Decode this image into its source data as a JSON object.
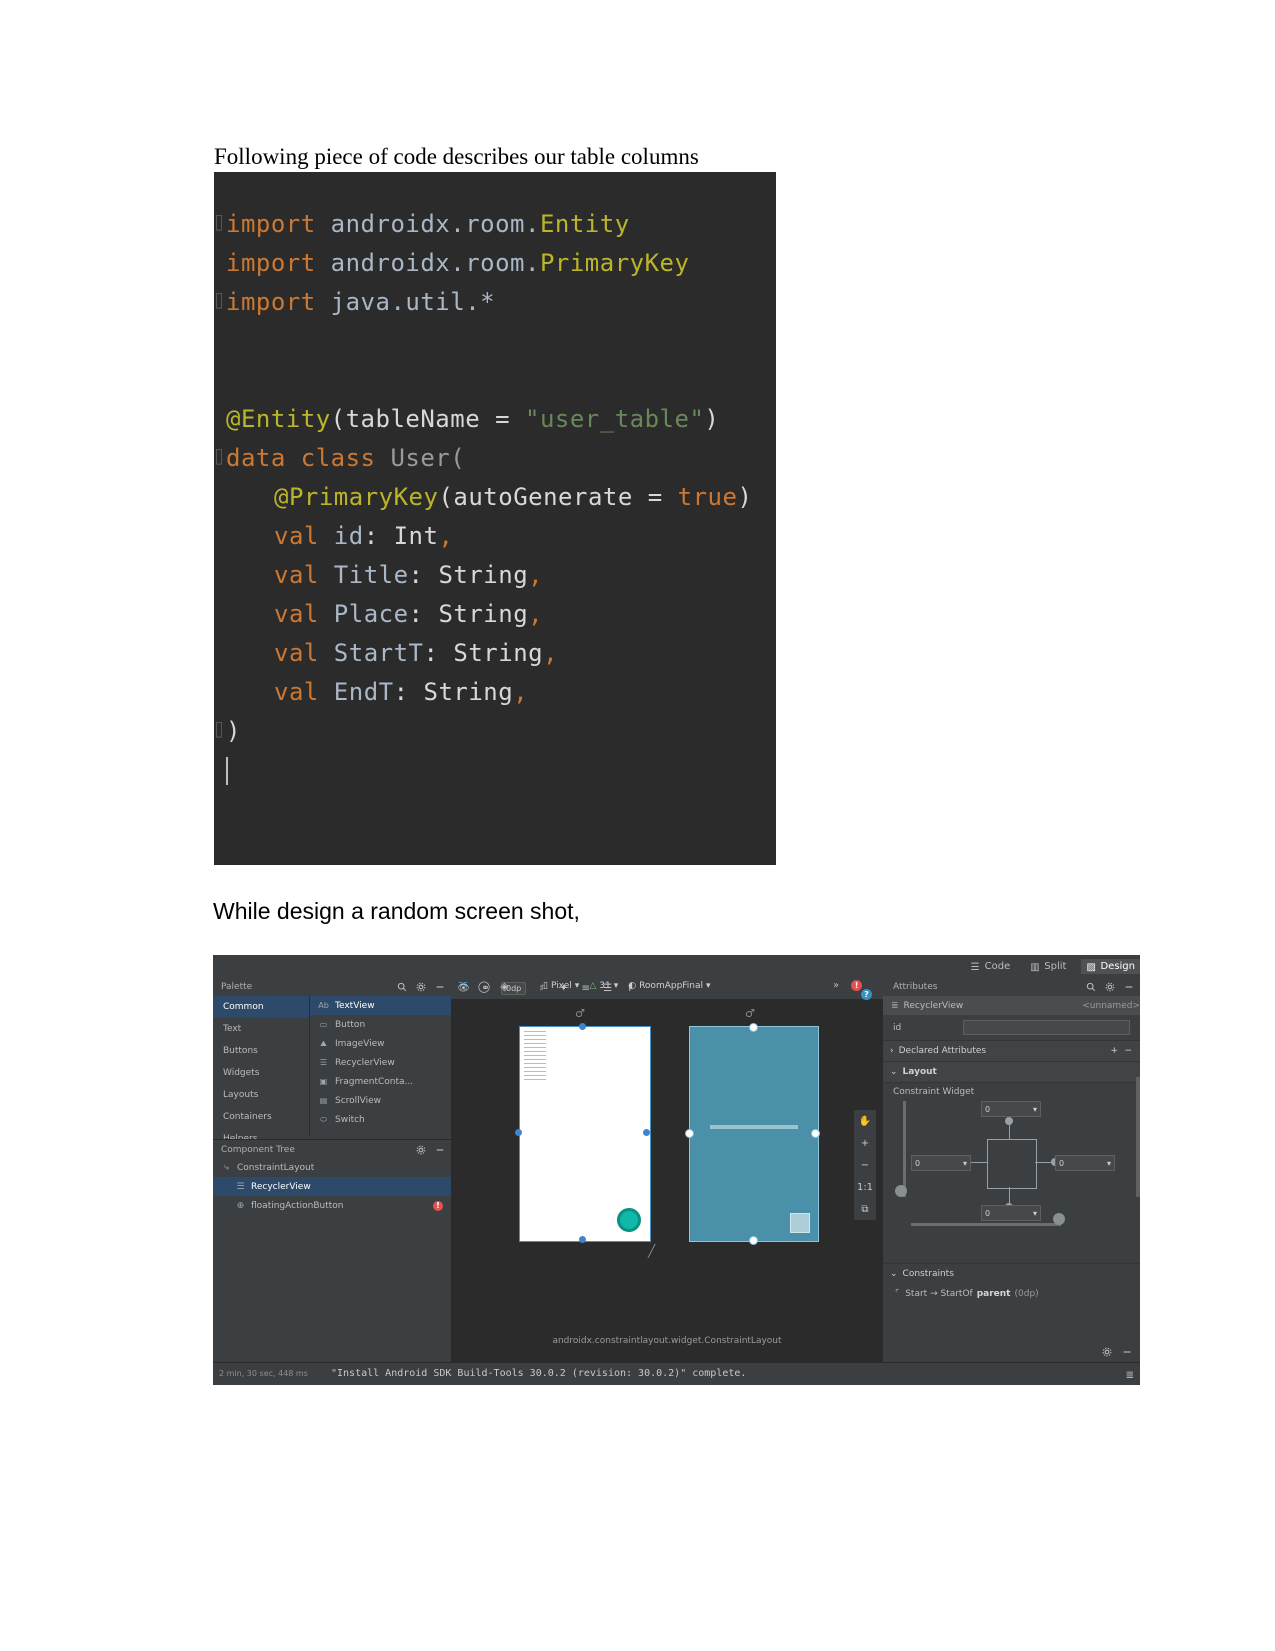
{
  "document": {
    "caption_1": "Following piece of code describes our table columns",
    "caption_2": "While design a random screen shot,"
  },
  "code_screenshot": {
    "language": "Kotlin",
    "lines": [
      {
        "indent": 0,
        "tokens": [
          {
            "t": "import",
            "c": "kw"
          },
          {
            "t": " androidx.room.",
            "c": "plain"
          },
          {
            "t": "Entity",
            "c": "ann"
          }
        ],
        "fold": true
      },
      {
        "indent": 0,
        "tokens": [
          {
            "t": "import",
            "c": "kw"
          },
          {
            "t": " androidx.room.",
            "c": "plain"
          },
          {
            "t": "PrimaryKey",
            "c": "ann"
          }
        ],
        "fold": false
      },
      {
        "indent": 0,
        "tokens": [
          {
            "t": "import",
            "c": "kw"
          },
          {
            "t": " java.util.*",
            "c": "plain"
          }
        ],
        "fold": true
      },
      {
        "indent": 0,
        "tokens": []
      },
      {
        "indent": 0,
        "tokens": []
      },
      {
        "indent": 0,
        "tokens": [
          {
            "t": "@Entity",
            "c": "ann"
          },
          {
            "t": "(tableName = ",
            "c": "white"
          },
          {
            "t": "\"user_table\"",
            "c": "str"
          },
          {
            "t": ")",
            "c": "white"
          }
        ],
        "fold": false
      },
      {
        "indent": 0,
        "tokens": [
          {
            "t": "data class ",
            "c": "kw"
          },
          {
            "t": "User(",
            "c": "ident"
          }
        ],
        "fold": true
      },
      {
        "indent": 1,
        "tokens": [
          {
            "t": "@PrimaryKey",
            "c": "ann"
          },
          {
            "t": "(autoGenerate = ",
            "c": "white"
          },
          {
            "t": "true",
            "c": "kw"
          },
          {
            "t": ")",
            "c": "white"
          }
        ],
        "fold": false
      },
      {
        "indent": 1,
        "tokens": [
          {
            "t": "val ",
            "c": "kw"
          },
          {
            "t": "id",
            "c": "plain"
          },
          {
            "t": ": ",
            "c": "white"
          },
          {
            "t": "Int",
            "c": "white"
          },
          {
            "t": ",",
            "c": "kw"
          }
        ],
        "fold": false
      },
      {
        "indent": 1,
        "tokens": [
          {
            "t": "val ",
            "c": "kw"
          },
          {
            "t": "Title",
            "c": "plain"
          },
          {
            "t": ": ",
            "c": "white"
          },
          {
            "t": "String",
            "c": "white"
          },
          {
            "t": ",",
            "c": "kw"
          }
        ],
        "fold": false
      },
      {
        "indent": 1,
        "tokens": [
          {
            "t": "val ",
            "c": "kw"
          },
          {
            "t": "Place",
            "c": "plain"
          },
          {
            "t": ": ",
            "c": "white"
          },
          {
            "t": "String",
            "c": "white"
          },
          {
            "t": ",",
            "c": "kw"
          }
        ],
        "fold": false
      },
      {
        "indent": 1,
        "tokens": [
          {
            "t": "val ",
            "c": "kw"
          },
          {
            "t": "StartT",
            "c": "plain"
          },
          {
            "t": ": ",
            "c": "white"
          },
          {
            "t": "String",
            "c": "white"
          },
          {
            "t": ",",
            "c": "kw"
          }
        ],
        "fold": false
      },
      {
        "indent": 1,
        "tokens": [
          {
            "t": "val ",
            "c": "kw"
          },
          {
            "t": "EndT",
            "c": "plain"
          },
          {
            "t": ": ",
            "c": "white"
          },
          {
            "t": "String",
            "c": "white"
          },
          {
            "t": ",",
            "c": "kw"
          }
        ],
        "fold": false
      },
      {
        "indent": 0,
        "tokens": [
          {
            "t": ")",
            "c": "white"
          }
        ],
        "fold": true
      }
    ],
    "colors": {
      "background": "#2b2b2b",
      "keyword": "#cc7832",
      "annotation": "#bbb529",
      "string": "#6a8759",
      "plain": "#a9b7c6",
      "identifier": "#9a9a9a"
    }
  },
  "android_studio": {
    "editor_tabs": [
      {
        "label": "Code",
        "icon": "code-lines-icon",
        "active": false
      },
      {
        "label": "Split",
        "icon": "split-pane-icon",
        "active": false
      },
      {
        "label": "Design",
        "icon": "design-preview-icon",
        "active": true
      }
    ],
    "palette": {
      "title": "Palette",
      "icons": [
        "search-icon",
        "gear-icon",
        "minimize-icon"
      ],
      "categories": [
        {
          "label": "Common",
          "selected": true
        },
        {
          "label": "Text",
          "selected": false
        },
        {
          "label": "Buttons",
          "selected": false
        },
        {
          "label": "Widgets",
          "selected": false
        },
        {
          "label": "Layouts",
          "selected": false
        },
        {
          "label": "Containers",
          "selected": false
        },
        {
          "label": "Helpers",
          "selected": false
        }
      ],
      "items": [
        {
          "label": "TextView",
          "icon": "Ab",
          "selected": true
        },
        {
          "label": "Button",
          "icon": "button-icon",
          "selected": false
        },
        {
          "label": "ImageView",
          "icon": "image-icon",
          "selected": false
        },
        {
          "label": "RecyclerView",
          "icon": "list-icon",
          "selected": false
        },
        {
          "label": "FragmentConta...",
          "icon": "fragment-icon",
          "selected": false
        },
        {
          "label": "ScrollView",
          "icon": "scroll-icon",
          "selected": false
        },
        {
          "label": "Switch",
          "icon": "switch-icon",
          "selected": false
        }
      ]
    },
    "component_tree": {
      "title": "Component Tree",
      "icons": [
        "gear-icon",
        "minimize-icon"
      ],
      "nodes": [
        {
          "label": "ConstraintLayout",
          "icon": "constraint-layout-icon",
          "depth": 0,
          "selected": false,
          "warning": false
        },
        {
          "label": "RecyclerView",
          "icon": "list-icon",
          "depth": 1,
          "selected": true,
          "warning": false
        },
        {
          "label": "floatingActionButton",
          "icon": "fab-icon",
          "depth": 1,
          "selected": false,
          "warning": true
        }
      ]
    },
    "design_toolbar": {
      "device": "Pixel",
      "api_level": "31",
      "theme": "RoomAppFinal",
      "dp_value": "0dp",
      "icons": [
        "eye-icon",
        "blueprint-toggle-icon",
        "orientation-icon",
        "device-icon",
        "api-icon",
        "theme-icon",
        "overflow-icon",
        "error-icon"
      ],
      "left_icons": [
        "visibility-icon",
        "eye-off-icon",
        "magnet-icon",
        "wand-icon",
        "align-icon",
        "distribute-icon",
        "guideline-icon"
      ]
    },
    "canvas": {
      "fqcn": "androidx.constraintlayout.widget.ConstraintLayout",
      "zoom_controls": [
        "pan-icon",
        "zoom-in-icon",
        "zoom-out-icon",
        "1:1",
        "zoom-fit-icon"
      ],
      "zoom_level": "1:1"
    },
    "attributes": {
      "title": "Attributes",
      "icons": [
        "search-icon",
        "gear-icon",
        "minimize-icon"
      ],
      "selected_component": "RecyclerView",
      "selected_id": "<unnamed>",
      "rows": [
        {
          "label": "id",
          "value": ""
        }
      ],
      "sections": [
        {
          "label": "Declared Attributes",
          "expanded": false,
          "actions": [
            "add-icon",
            "remove-icon"
          ]
        },
        {
          "label": "Layout",
          "expanded": true
        }
      ],
      "constraint_widget": {
        "title": "Constraint Widget",
        "top": "0",
        "left": "0",
        "right": "0",
        "bottom": "0"
      },
      "constraints": {
        "title": "Constraints",
        "items": [
          {
            "icon": "constraint-icon",
            "text": "Start → StartOf",
            "target": "parent",
            "value": "(0dp)"
          }
        ]
      }
    },
    "build_output": {
      "message": "\"Install Android SDK Build-Tools 30.0.2 (revision: 30.0.2)\" complete.",
      "timestamp": "2 min, 30 sec, 448 ms",
      "icons": [
        "gear-icon",
        "minimize-icon",
        "list-icon"
      ]
    }
  }
}
